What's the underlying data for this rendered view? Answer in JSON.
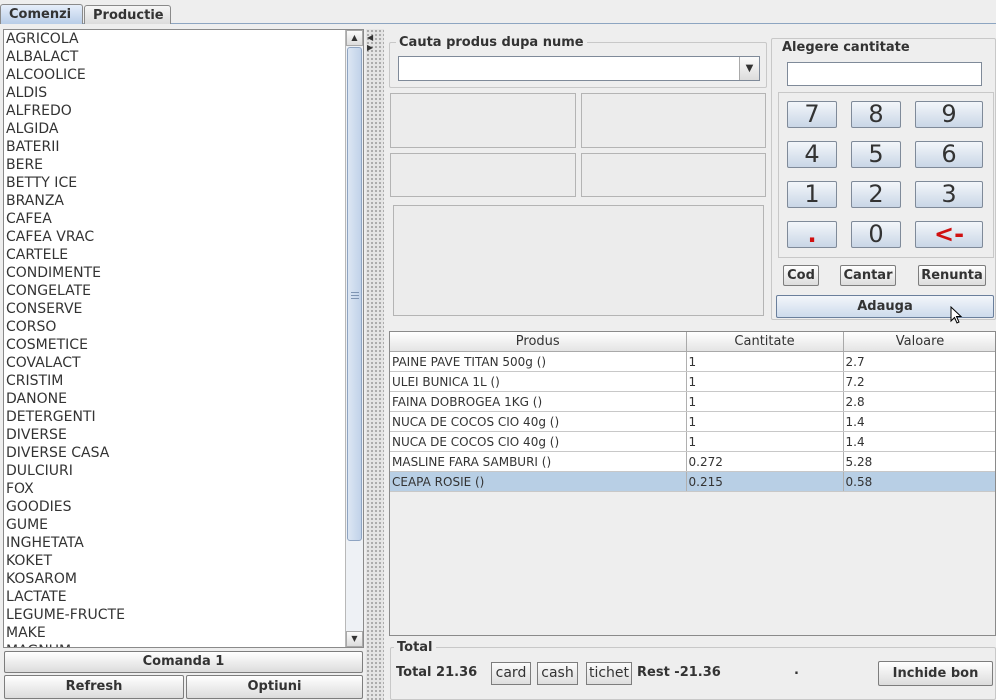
{
  "tabs": [
    "Comenzi",
    "Productie"
  ],
  "categories": [
    "AGRICOLA",
    "ALBALACT",
    "ALCOOLICE",
    "ALDIS",
    "ALFREDO",
    "ALGIDA",
    "BATERII",
    "BERE",
    "BETTY ICE",
    "BRANZA",
    "CAFEA",
    "CAFEA VRAC",
    "CARTELE",
    "CONDIMENTE",
    "CONGELATE",
    "CONSERVE",
    "CORSO",
    "COSMETICE",
    "COVALACT",
    "CRISTIM",
    "DANONE",
    "DETERGENTI",
    "DIVERSE",
    "DIVERSE CASA",
    "DULCIURI",
    "FOX",
    "GOODIES",
    "GUME",
    "INGHETATA",
    "KOKET",
    "KOSAROM",
    "LACTATE",
    "LEGUME-FRUCTE",
    "MAKE",
    "MAGNUM"
  ],
  "left_buttons": {
    "comanda": "Comanda 1",
    "refresh": "Refresh",
    "optiuni": "Optiuni"
  },
  "search": {
    "label": "Cauta produs dupa nume",
    "value": ""
  },
  "quantity": {
    "label": "Alegere cantitate",
    "value": "",
    "keys": [
      "7",
      "8",
      "9",
      "4",
      "5",
      "6",
      "1",
      "2",
      "3",
      ".",
      "0",
      "<-"
    ],
    "cod": "Cod",
    "cantar": "Cantar",
    "renunta": "Renunta",
    "adauga": "Adauga"
  },
  "table": {
    "headers": [
      "Produs",
      "Cantitate",
      "Valoare"
    ],
    "rows": [
      [
        "PAINE PAVE TITAN 500g ()",
        "1",
        "2.7"
      ],
      [
        "ULEI BUNICA 1L ()",
        "1",
        "7.2"
      ],
      [
        "FAINA DOBROGEA 1KG ()",
        "1",
        "2.8"
      ],
      [
        "NUCA DE COCOS CIO 40g ()",
        "1",
        "1.4"
      ],
      [
        "NUCA DE COCOS CIO 40g ()",
        "1",
        "1.4"
      ],
      [
        "MASLINE FARA SAMBURI  ()",
        "0.272",
        "5.28"
      ],
      [
        "CEAPA ROSIE ()",
        "0.215",
        "0.58"
      ]
    ],
    "selected_row": 6
  },
  "total": {
    "group_label": "Total",
    "total_text": "Total 21.36",
    "card": "card",
    "cash": "cash",
    "tichet": "tichet",
    "rest_text": "Rest -21.36",
    "dot": ".",
    "inchide": "Inchide bon"
  },
  "colors": {
    "accent": "#b8cfe5",
    "backspace_red": "#d01010"
  }
}
